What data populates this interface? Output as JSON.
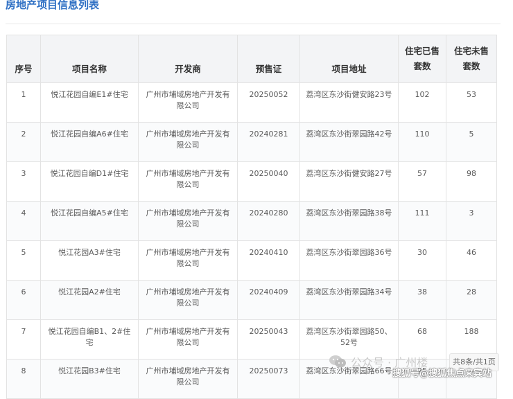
{
  "page": {
    "title": "房地产项目信息列表"
  },
  "table": {
    "headers": [
      {
        "label": "序号"
      },
      {
        "label": "项目名称"
      },
      {
        "label": "开发商"
      },
      {
        "label": "预售证"
      },
      {
        "label": "项目地址"
      },
      {
        "label": "住宅已售套数"
      },
      {
        "label": "住宅未售套数"
      }
    ],
    "rows": [
      {
        "no": "1",
        "name": "悦江花园自编E1#住宅",
        "developer": "广州市埔域房地产开发有限公司",
        "permit": "20250052",
        "address": "荔湾区东沙街健安路23号",
        "sold": "102",
        "unsold": "53"
      },
      {
        "no": "2",
        "name": "悦江花园自编A6#住宅",
        "developer": "广州市埔域房地产开发有限公司",
        "permit": "20240281",
        "address": "荔湾区东沙街翠园路42号",
        "sold": "110",
        "unsold": "5"
      },
      {
        "no": "3",
        "name": "悦江花园自编D1#住宅",
        "developer": "广州市埔域房地产开发有限公司",
        "permit": "20250040",
        "address": "荔湾区东沙街健安路27号",
        "sold": "57",
        "unsold": "98"
      },
      {
        "no": "4",
        "name": "悦江花园自编A5#住宅",
        "developer": "广州市埔域房地产开发有限公司",
        "permit": "20240280",
        "address": "荔湾区东沙街翠园路38号",
        "sold": "111",
        "unsold": "3"
      },
      {
        "no": "5",
        "name": "悦江花园A3#住宅",
        "developer": "广州市埔域房地产开发有限公司",
        "permit": "20240410",
        "address": "荔湾区东沙街翠园路36号",
        "sold": "30",
        "unsold": "46"
      },
      {
        "no": "6",
        "name": "悦江花园A2#住宅",
        "developer": "广州市埔域房地产开发有限公司",
        "permit": "20240409",
        "address": "荔湾区东沙街翠园路34号",
        "sold": "38",
        "unsold": "28"
      },
      {
        "no": "7",
        "name": "悦江花园自编B1、2#住宅",
        "developer": "广州市埔域房地产开发有限公司",
        "permit": "20250043",
        "address": "荔湾区东沙街翠园路50、52号",
        "sold": "68",
        "unsold": "188"
      },
      {
        "no": "8",
        "name": "悦江花园B3#住宅",
        "developer": "广州市埔域房地产开发有限公司",
        "permit": "20250073",
        "address": "荔湾区东沙街翠园路66号",
        "sold": "25",
        "unsold": "167"
      }
    ]
  },
  "pagination": {
    "summary": "共8条/共1页"
  },
  "watermark": {
    "wechat_text": "公众号 · 广州楼",
    "wechat_icon": "wechat-icon",
    "source_text": "搜狐号@搜狐焦点来宾站"
  }
}
